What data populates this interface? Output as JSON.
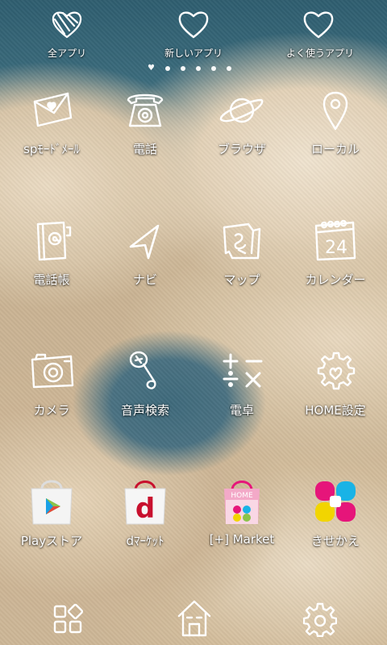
{
  "top_bar": {
    "items": [
      {
        "label": "全アプリ",
        "icon": "heart-striped-icon"
      },
      {
        "label": "新しいアプリ",
        "icon": "heart-outline-icon"
      },
      {
        "label": "よく使うアプリ",
        "icon": "heart-outline-icon"
      }
    ],
    "page_indicator": {
      "total": 6,
      "current": 1
    }
  },
  "apps": [
    {
      "label": "spﾓｰﾄﾞﾒｰﾙ",
      "icon": "mail-icon"
    },
    {
      "label": "電話",
      "icon": "phone-icon"
    },
    {
      "label": "ブラウザ",
      "icon": "browser-planet-icon"
    },
    {
      "label": "ローカル",
      "icon": "map-pin-icon"
    },
    {
      "label": "電話帳",
      "icon": "address-book-icon"
    },
    {
      "label": "ナビ",
      "icon": "navigation-arrow-icon"
    },
    {
      "label": "マップ",
      "icon": "map-icon"
    },
    {
      "label": "カレンダー",
      "icon": "calendar-icon"
    },
    {
      "label": "カメラ",
      "icon": "camera-icon"
    },
    {
      "label": "音声検索",
      "icon": "microphone-icon"
    },
    {
      "label": "電卓",
      "icon": "calculator-icon"
    },
    {
      "label": "HOME設定",
      "icon": "home-settings-gear-icon"
    },
    {
      "label": "Playストア",
      "icon": "play-store-bag-icon"
    },
    {
      "label": "dﾏｰｹｯﾄ",
      "icon": "d-market-bag-icon"
    },
    {
      "label": "[+] Market",
      "icon": "home-market-bag-icon"
    },
    {
      "label": "きせかえ",
      "icon": "kisekae-icon"
    }
  ],
  "dock": [
    {
      "icon": "app-grid-icon"
    },
    {
      "icon": "home-icon"
    },
    {
      "icon": "settings-gear-icon"
    }
  ],
  "calendar_day": "24",
  "colors": {
    "sky": "#3b6b7c",
    "cloud": "#e3d2b8",
    "play_green": "#4cb748",
    "d_red": "#c8102e",
    "kisekae_pink": "#e6157a",
    "kisekae_cyan": "#19b3e6",
    "kisekae_yellow": "#f2d500"
  }
}
